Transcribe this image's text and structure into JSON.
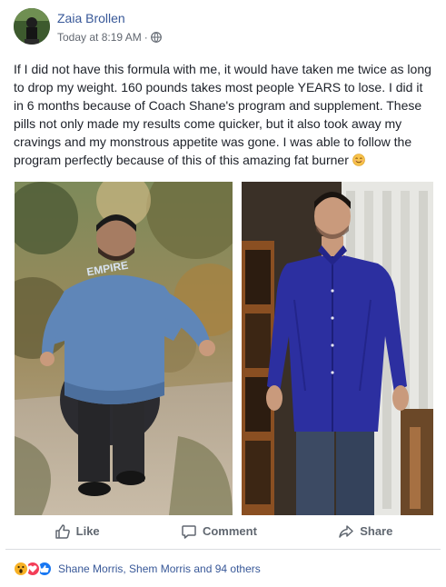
{
  "post": {
    "author_name": "Zaia Brollen",
    "timestamp": "Today at 8:19 AM",
    "separator": "·",
    "privacy_icon": "globe-icon",
    "text": "If I did not have this formula with me, it would have taken me twice as long to drop my weight. 160 pounds takes most people YEARS to lose. I did it in 6 months because of Coach Shane's program and supplement. These pills not only made my results come quicker, but it also took away my cravings and my monstrous appetite was gone. I was able to follow the program perfectly because of this of this amazing fat burner",
    "text_emoji": "smiling-face-icon",
    "images": {
      "before_shirt_text": "EMPIRE"
    }
  },
  "actions": {
    "like_label": "Like",
    "comment_label": "Comment",
    "share_label": "Share"
  },
  "reactions": {
    "icons": [
      "wow-icon",
      "love-icon",
      "like-icon"
    ],
    "names": "Shane Morris, Shem Morris and 94 others"
  },
  "colors": {
    "link_blue": "#385898",
    "meta_gray": "#616770",
    "action_gray": "#606770",
    "like_blue": "#1877f2",
    "love_red": "#f33e58",
    "wow_yellow": "#f7b125"
  }
}
